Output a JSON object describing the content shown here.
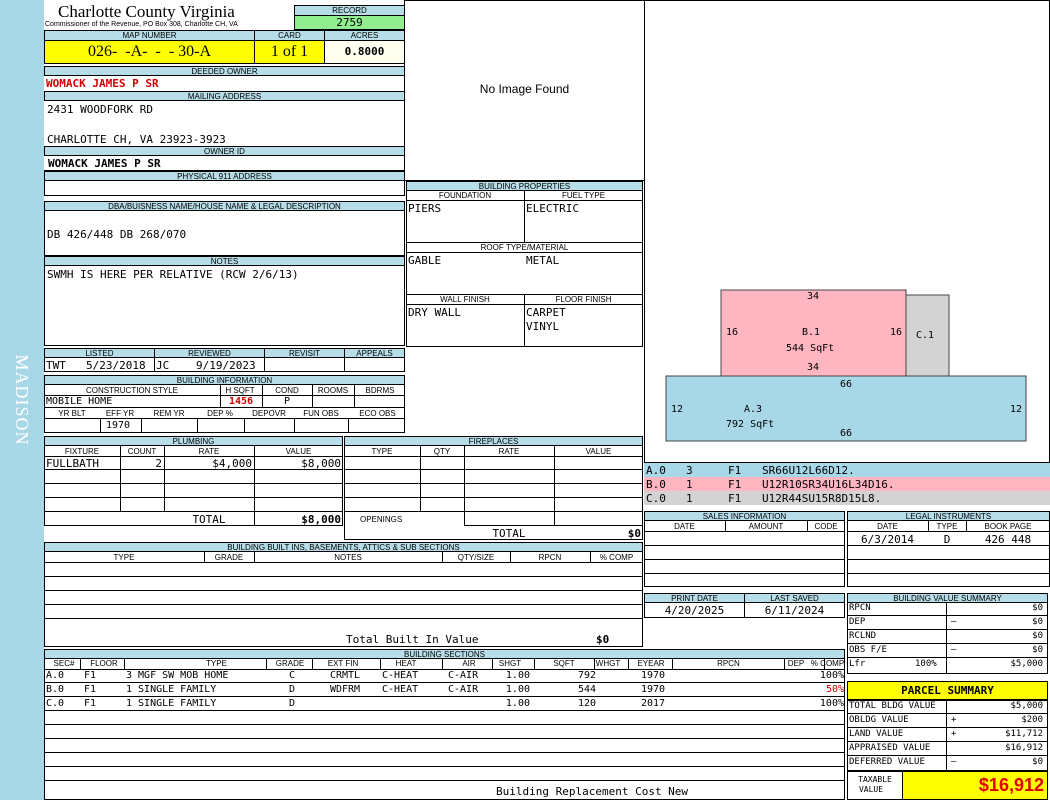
{
  "side_label": "MADISON",
  "header": {
    "county": "Charlotte County Virginia",
    "commissioner": "Commissioner of the Revenue, PO Box 308, Charlotte CH, VA",
    "record_label": "RECORD",
    "record": "2759",
    "map_number_label": "MAP NUMBER",
    "map_number": "026-  -A-  -  - 30-A",
    "card_label": "CARD",
    "card": "1 of 1",
    "acres_label": "ACRES",
    "acres": "0.8000"
  },
  "owner": {
    "deeded_owner_label": "DEEDED OWNER",
    "deeded_owner": "WOMACK JAMES P SR",
    "mailing_label": "MAILING ADDRESS",
    "mailing_line1": "2431 WOODFORK RD",
    "mailing_line2": "CHARLOTTE CH, VA 23923-3923",
    "owner_id_label": "OWNER ID",
    "owner_id": "WOMACK JAMES P SR",
    "physical_label": "PHYSICAL 911 ADDRESS",
    "physical": ""
  },
  "image_placeholder": "No Image Found",
  "dba": {
    "label": "DBA/BUISNESS NAME/HOUSE NAME & LEGAL DESCRIPTION",
    "text": "DB 426/448 DB 268/070"
  },
  "notes": {
    "label": "NOTES",
    "text": "SWMH IS HERE PER RELATIVE (RCW 2/6/13)"
  },
  "building_properties": {
    "label": "BUILDING PROPERTIES",
    "foundation_label": "FOUNDATION",
    "foundation": "PIERS",
    "fuel_label": "FUEL TYPE",
    "fuel": "ELECTRIC",
    "roof_label": "ROOF TYPE/MATERIAL",
    "roof_type": "GABLE",
    "roof_material": "METAL",
    "wall_label": "WALL FINISH",
    "wall": "DRY WALL",
    "floor_label": "FLOOR FINISH",
    "floor1": "CARPET",
    "floor2": "VINYL"
  },
  "listing": {
    "listed_label": "LISTED",
    "listed_by": "TWT",
    "listed_date": "5/23/2018",
    "reviewed_label": "REVIEWED",
    "reviewed_by": "JC",
    "reviewed_date": "9/19/2023",
    "revisit_label": "REVISIT",
    "appeals_label": "APPEALS"
  },
  "building_info": {
    "label": "BUILDING INFORMATION",
    "style_label": "CONSTRUCTION STYLE",
    "style": "MOBILE HOME",
    "hsqft_label": "H SQFT",
    "hsqft": "1456",
    "cond_label": "COND",
    "cond": "P",
    "rooms_label": "ROOMS",
    "bdrms_label": "BDRMS",
    "yrblt_label": "YR BLT",
    "effyr_label": "EFF YR",
    "effyr": "1970",
    "remyr_label": "REM YR",
    "dep_label": "DEP %",
    "depovr_label": "DEPOVR",
    "funobs_label": "FUN OBS",
    "ecoobs_label": "ECO OBS"
  },
  "plumbing": {
    "label": "PLUMBING",
    "headers": [
      "FIXTURE",
      "COUNT",
      "RATE",
      "VALUE"
    ],
    "rows": [
      {
        "fixture": "FULLBATH",
        "count": "2",
        "rate": "$4,000",
        "value": "$8,000"
      }
    ],
    "total_label": "TOTAL",
    "total": "$8,000"
  },
  "fireplaces": {
    "label": "FIREPLACES",
    "headers": [
      "TYPE",
      "QTY",
      "RATE",
      "VALUE"
    ],
    "openings_label": "OPENINGS",
    "total_label": "TOTAL",
    "total": "$0"
  },
  "built_ins": {
    "label": "BUILDING BUILT INS, BASEMENTS, ATTICS & SUB SECTIONS",
    "headers": [
      "TYPE",
      "GRADE",
      "NOTES",
      "QTY/SIZE",
      "RPCN",
      "% COMP"
    ],
    "total_label": "Total Built In Value",
    "total": "$0"
  },
  "sketch": {
    "b1_label": "B.1",
    "b1_area": "544 SqFt",
    "b1_top": "34",
    "b1_bottom": "34",
    "b1_left": "16",
    "b1_right": "16",
    "c1_label": "C.1",
    "a3_label": "A.3",
    "a3_area": "792 SqFt",
    "a3_top": "66",
    "a3_bottom": "66",
    "a3_left": "12",
    "a3_right": "12",
    "colors": {
      "a": "#a8d8e8",
      "b": "#ffb6c1",
      "c": "#d3d3d3"
    }
  },
  "vectors": [
    {
      "sec": "A.0",
      "n": "3",
      "floor": "F1",
      "code": "SR66U12L66D12."
    },
    {
      "sec": "B.0",
      "n": "1",
      "floor": "F1",
      "code": "U12R10SR34U16L34D16."
    },
    {
      "sec": "C.0",
      "n": "1",
      "floor": "F1",
      "code": "U12R44SU15R8D15L8."
    }
  ],
  "sales": {
    "label": "SALES INFORMATION",
    "headers": [
      "DATE",
      "AMOUNT",
      "CODE"
    ]
  },
  "legal": {
    "label": "LEGAL INSTRUMENTS",
    "headers": [
      "DATE",
      "TYPE",
      "BOOK PAGE"
    ],
    "rows": [
      {
        "date": "6/3/2014",
        "type": "D",
        "book": "426 448"
      }
    ]
  },
  "print": {
    "print_label": "PRINT DATE",
    "print_date": "4/20/2025",
    "saved_label": "LAST SAVED",
    "saved_date": "6/11/2024"
  },
  "value_summary": {
    "label": "BUILDING VALUE SUMMARY",
    "rpcn_label": "RPCN",
    "rpcn": "$0",
    "dep_label": "DEP",
    "dep_sign": "–",
    "dep": "$0",
    "rclnd_label": "RCLND",
    "rclnd": "$0",
    "obs_label": "OBS F/E",
    "obs_sign": "–",
    "obs": "$0",
    "lfr_label": "Lfr",
    "lfr_pct": "100%",
    "lfr": "$5,000"
  },
  "parcel": {
    "label": "PARCEL SUMMARY",
    "total_bldg_label": "TOTAL BLDG VALUE",
    "total_bldg": "$5,000",
    "obldg_label": "OBLDG VALUE",
    "obldg_sign": "+",
    "obldg": "$200",
    "land_label": "LAND VALUE",
    "land_sign": "+",
    "land": "$11,712",
    "appraised_label": "APPRAISED VALUE",
    "appraised": "$16,912",
    "deferred_label": "DEFERRED VALUE",
    "deferred_sign": "–",
    "deferred": "$0",
    "taxable_label1": "TAXABLE",
    "taxable_label2": "VALUE",
    "taxable": "$16,912"
  },
  "sections": {
    "label": "BUILDING SECTIONS",
    "headers": [
      "SEC#",
      "FLOOR",
      "TYPE",
      "GRADE",
      "EXT FIN",
      "HEAT",
      "AIR",
      "SHGT",
      "SQFT",
      "WHGT",
      "EYEAR",
      "RPCN",
      "DEP",
      "% COMP"
    ],
    "rows": [
      {
        "sec": "A.0",
        "floor": "F1",
        "type": "3 MGF SW MOB HOME",
        "grade": "C",
        "ext": "CRMTL",
        "heat": "C-HEAT",
        "air": "C-AIR",
        "shgt": "1.00",
        "sqft": "792",
        "eyear": "1970",
        "comp": "100%",
        "comp_red": false
      },
      {
        "sec": "B.0",
        "floor": "F1",
        "type": "1 SINGLE FAMILY",
        "grade": "D",
        "ext": "WDFRM",
        "heat": "C-HEAT",
        "air": "C-AIR",
        "shgt": "1.00",
        "sqft": "544",
        "eyear": "1970",
        "comp": "50%",
        "comp_red": true
      },
      {
        "sec": "C.0",
        "floor": "F1",
        "type": "1 SINGLE FAMILY",
        "grade": "D",
        "ext": "",
        "heat": "",
        "air": "",
        "shgt": "1.00",
        "sqft": "120",
        "eyear": "2017",
        "comp": "100%",
        "comp_red": false
      }
    ],
    "footer": "Building Replacement Cost New"
  }
}
